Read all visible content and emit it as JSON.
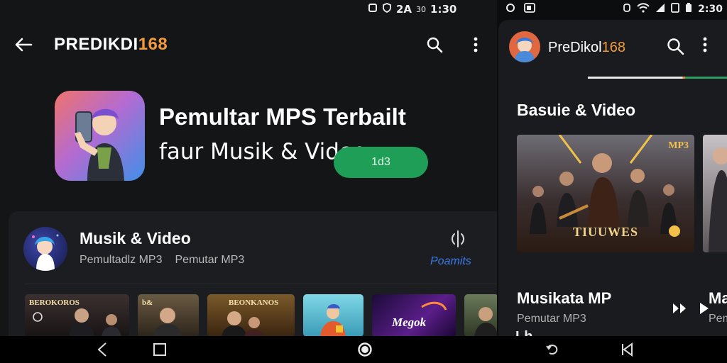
{
  "left_status": {
    "time": "1:30",
    "battery": "30",
    "extra": "2A"
  },
  "left_app": {
    "brand_white": "PREDIKDI",
    "brand_orange": "168",
    "title": "Pemultar MPS Terbailt",
    "subtitle": "faur Musik & Video",
    "install_label": "1d3",
    "channel_title": "Musik & Video",
    "channel_sub1": "Pemultadlz MP3",
    "channel_sub2": "Pemutar MP3",
    "follow_label": "Poamits",
    "thumbs": [
      {
        "caption": "BEROKOROS"
      },
      {
        "caption": "b&"
      },
      {
        "caption": "BEONKANOS"
      },
      {
        "caption": ""
      },
      {
        "caption": "Megok"
      },
      {
        "caption": ""
      }
    ]
  },
  "right_status": {
    "time": "2:30"
  },
  "right_app": {
    "title_white": "PreDikol",
    "title_orange": "168",
    "section_title": "Basuie & Video",
    "poster_label": "TIUUWES",
    "poster_badge": "MP3",
    "track_title": "Musikata MP",
    "track_sub": "Pemutar MP3",
    "track2_title": "Ma",
    "track2_sub": "Pem",
    "peek_label": "Lh"
  },
  "colors": {
    "accent_green": "#1f9e57",
    "brand_orange": "#f29a3e",
    "link_blue": "#3c7be8"
  }
}
